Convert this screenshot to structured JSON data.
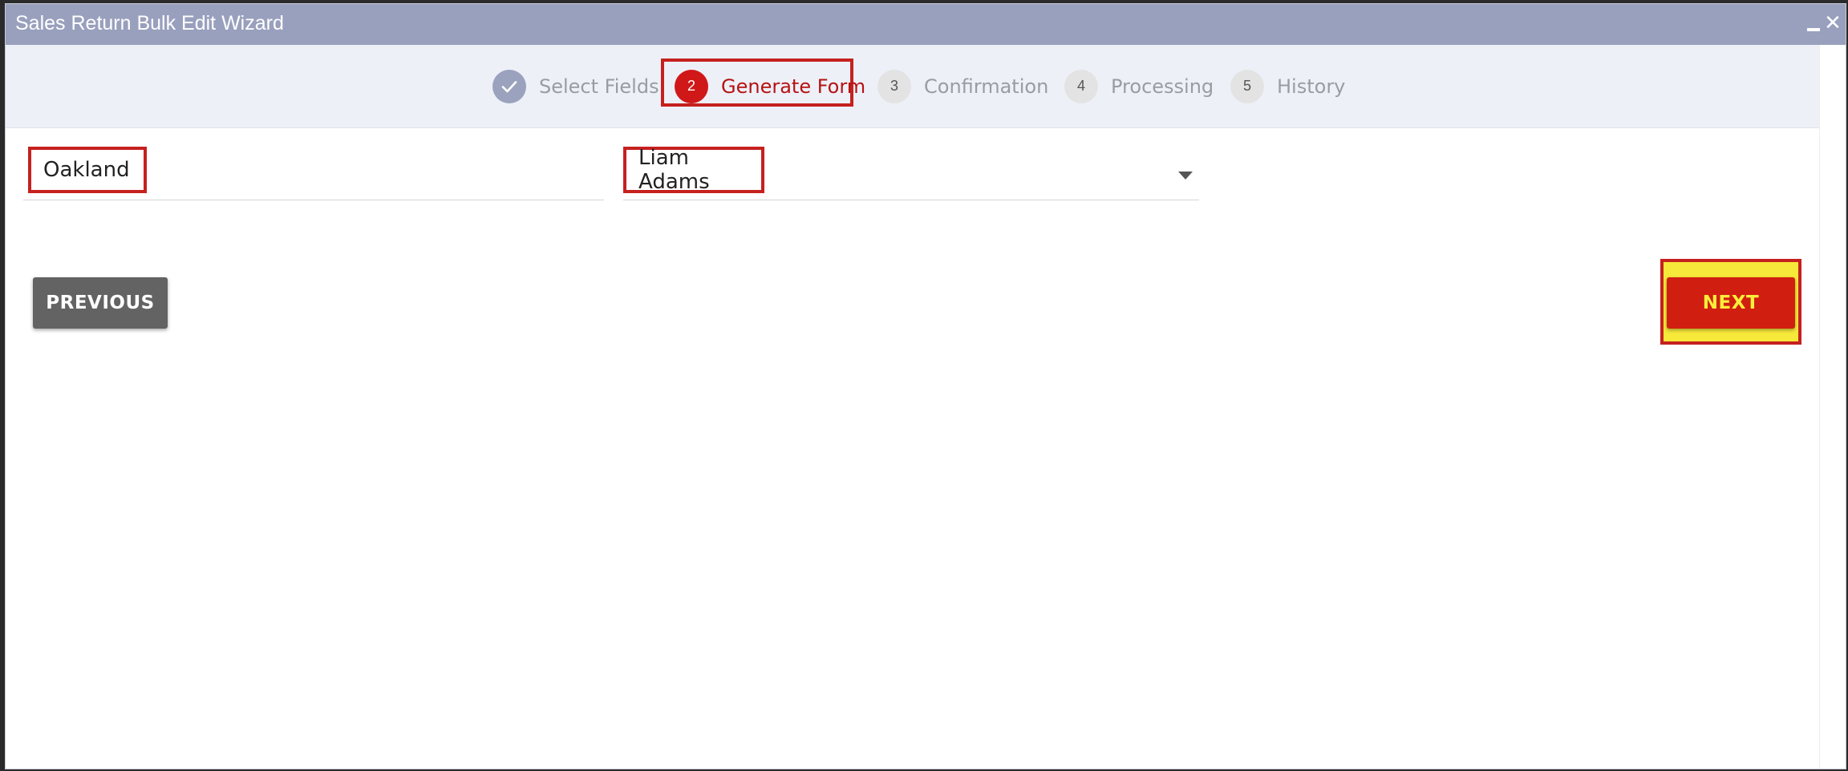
{
  "window": {
    "title": "Sales Return Bulk Edit Wizard",
    "minimize_label": "minimize",
    "close_label": "close"
  },
  "stepper": {
    "steps": [
      {
        "number": "✓",
        "label": "Select Fields",
        "state": "done"
      },
      {
        "number": "2",
        "label": "Generate Form",
        "state": "active"
      },
      {
        "number": "3",
        "label": "Confirmation",
        "state": "pending"
      },
      {
        "number": "4",
        "label": "Processing",
        "state": "pending"
      },
      {
        "number": "5",
        "label": "History",
        "state": "pending"
      }
    ]
  },
  "form": {
    "field1": {
      "value": "Oakland"
    },
    "field2": {
      "value": "Liam Adams"
    }
  },
  "actions": {
    "previous_label": "PREVIOUS",
    "next_label": "NEXT"
  },
  "colors": {
    "titlebar": "#99a0bd",
    "accent_red": "#d01818",
    "next_highlight": "#f7e93a",
    "next_text": "#f9ee3a",
    "previous_button": "#636363"
  }
}
